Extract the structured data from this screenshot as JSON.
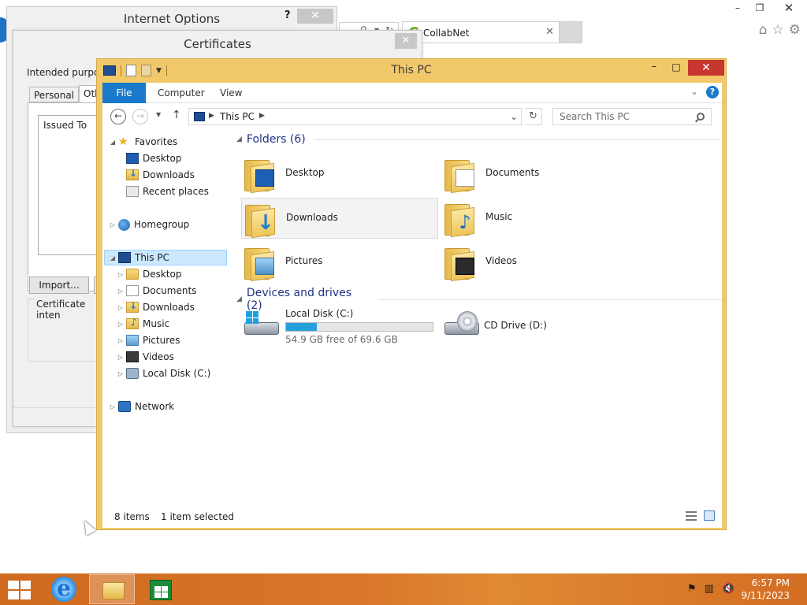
{
  "browser": {
    "tab_label": "CollabNet",
    "tab_close_glyph": "✕",
    "window_buttons": {
      "minimize": "–",
      "restore": "❐",
      "close": "✕"
    },
    "toolbar_icons": [
      "home-icon",
      "star-icon",
      "gear-icon"
    ]
  },
  "internet_options": {
    "title": "Internet Options",
    "help": "?",
    "close": "✕"
  },
  "certificates": {
    "title": "Certificates",
    "close": "✕",
    "intended_purpose_label": "Intended purpose",
    "tabs": [
      "Personal",
      "Other"
    ],
    "column_issued_to": "Issued To",
    "import_button": "Import...",
    "group_label": "Certificate inten"
  },
  "explorer": {
    "title": "This PC",
    "window_buttons": {
      "minimize": "–",
      "maximize": "□",
      "close": "✕"
    },
    "ribbon": {
      "file": "File",
      "computer": "Computer",
      "view": "View",
      "help": "?"
    },
    "address": {
      "location": "This PC"
    },
    "search": {
      "placeholder": "Search This PC"
    },
    "nav": {
      "favorites": "Favorites",
      "desktop": "Desktop",
      "downloads": "Downloads",
      "recent_places": "Recent places",
      "homegroup": "Homegroup",
      "this_pc": "This PC",
      "pc_children": [
        "Desktop",
        "Documents",
        "Downloads",
        "Music",
        "Pictures",
        "Videos",
        "Local Disk (C:)"
      ],
      "network": "Network"
    },
    "folders_header": "Folders (6)",
    "folders": [
      {
        "label": "Desktop",
        "icon": "desktop-folder-icon"
      },
      {
        "label": "Documents",
        "icon": "documents-folder-icon"
      },
      {
        "label": "Downloads",
        "icon": "downloads-folder-icon"
      },
      {
        "label": "Music",
        "icon": "music-folder-icon"
      },
      {
        "label": "Pictures",
        "icon": "pictures-folder-icon"
      },
      {
        "label": "Videos",
        "icon": "videos-folder-icon"
      }
    ],
    "devices_header": "Devices and drives (2)",
    "drives": {
      "local": {
        "label": "Local Disk (C:)",
        "free_text": "54.9 GB free of 69.6 GB",
        "used_fraction": 0.21
      },
      "cd": {
        "label": "CD Drive (D:)"
      }
    },
    "status": {
      "item_count": "8 items",
      "selection": "1 item selected"
    }
  },
  "taskbar": {
    "apps": [
      "Internet Explorer",
      "File Explorer",
      "Store"
    ],
    "active_app": "File Explorer",
    "clock_time": "6:57 PM",
    "clock_date": "9/11/2023"
  },
  "colors": {
    "accent": "#1979ca",
    "explorer_frame": "#f2c96a",
    "close_red": "#c7362f",
    "taskbar": "#d9762a",
    "drive_bar": "#26a0da"
  }
}
